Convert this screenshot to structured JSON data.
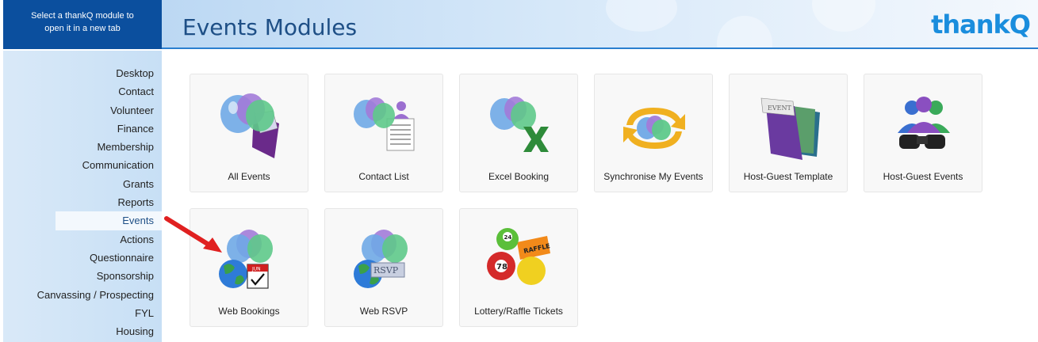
{
  "sidebar_header": {
    "line1": "Select a thankQ module to",
    "line2": "open it in a new tab"
  },
  "header": {
    "title": "Events Modules",
    "logo": "thankQ"
  },
  "nav": [
    "Desktop",
    "Contact",
    "Volunteer",
    "Finance",
    "Membership",
    "Communication",
    "Grants",
    "Reports",
    "Events",
    "Actions",
    "Questionnaire",
    "Sponsorship",
    "Canvassing / Prospecting",
    "FYL",
    "Housing"
  ],
  "nav_active": "Events",
  "modules": {
    "all_events": "All Events",
    "contact_list": "Contact List",
    "excel_booking": "Excel Booking",
    "sync_events": "Synchronise My Events",
    "host_guest_template": "Host-Guest Template",
    "host_guest_events": "Host-Guest Events",
    "web_bookings": "Web Bookings",
    "web_rsvp": "Web RSVP",
    "lottery_raffle": "Lottery/Raffle Tickets"
  },
  "icon_text": {
    "calendar_month": "JUN",
    "rsvp": "RSVP",
    "raffle": "RAFFLE",
    "ball_24": "24",
    "ball_78": "78",
    "event": "EVENT"
  },
  "colors": {
    "accent": "#0b4f9e",
    "title": "#1e4f86",
    "logo": "#1a8ddd",
    "arrow": "#e02020"
  }
}
